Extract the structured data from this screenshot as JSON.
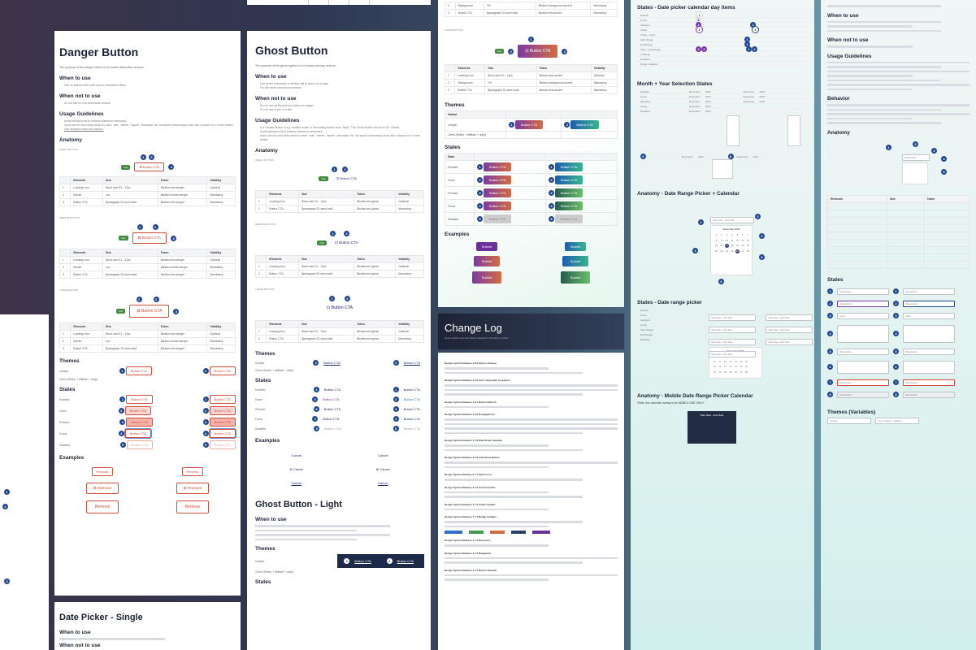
{
  "danger": {
    "title": "Danger Button",
    "intro": "The purpose of the danger button is to enable destructive actions.",
    "when_to_use": "When to use",
    "when_to_use_items": [
      "Use for actions that could have a destructive effect."
    ],
    "when_not": "When not to use",
    "when_not_items": [
      "Do not use for non-destructive actions"
    ],
    "usage": "Usage Guidelines",
    "usage_items": [
      "Avoid adding icons to buttons whenever necessary.",
      "Icons can be used when action is clear: 'add', 'delete', 'import', 'download' etc. but avoid unnecessary icons like a house on a 'home' button.",
      "Use sentence case with caution."
    ],
    "anatomy": "Anatomy",
    "small_label": "Small button",
    "medium_label": "Medium button",
    "large_label": "Large button",
    "cta": "Button CTA",
    "chip": "Chip",
    "table_headers": [
      "",
      "Elements",
      "Size",
      "Token",
      "Visibility"
    ],
    "table_rows": [
      [
        "1",
        "Leading Icon",
        "$icon.size.S1 - 12px",
        "$button.text.danger",
        "Optional"
      ],
      [
        "2",
        "Border",
        "1px",
        "$button.border.danger",
        "Mandatory"
      ],
      [
        "3",
        "Button CTA",
        "$paragraph.S1.semi-bold",
        "$button.text.danger",
        "Mandatory"
      ]
    ],
    "themes": "Themes",
    "theme_rows": [
      "Unstyle",
      "Client (Select + affiliate + unify)"
    ],
    "states": "States",
    "state_rows": [
      "Enabled",
      "Hover",
      "Pressed",
      "Focus",
      "Disabled"
    ],
    "examples": "Examples",
    "remove": "Remove"
  },
  "datepicker_single": {
    "title": "Date Picker - Single",
    "when_to_use": "When to use",
    "when_not": "When not to use"
  },
  "ghost": {
    "title": "Ghost Button",
    "intro": "The purpose of the ghost system is for tertiary primary actions.",
    "when_to_use": "When to use",
    "when_to_use_items": [
      "Use as the secondary or tertiary call to action on a page.",
      "For the fewer pronounced actions"
    ],
    "when_not": "When not to use",
    "when_not_items": [
      "Do not use as the primary button on a page.",
      "Do not use in lieu of a link"
    ],
    "usage": "Usage Guidelines",
    "usage_items": [
      "If a Primary Button is e.g. forward action, a Secondary Button is for 'Back'. The Ghost Button should be for 'Cancel'.",
      "Avoid adding icons to buttons whenever necessary.",
      "Icons can be used when action is clear: 'add', 'delete', 'import', 'download' etc. but avoid unnecessary icons like a house on a 'home' button."
    ],
    "anatomy": "Anatomy",
    "small_label": "Small button",
    "medium_label": "Medium button",
    "large_label": "Large button",
    "cta": "Button CTA",
    "chip": "Chip",
    "table_headers": [
      "",
      "Elements",
      "Size",
      "Token",
      "Visibility"
    ],
    "table_rows": [
      [
        "1",
        "Leading Icon",
        "$icon.size.S1 - 12px",
        "$button.text.ghost",
        "Optional"
      ],
      [
        "2",
        "Button CTA",
        "$paragraph.S1.semi-bold",
        "$button.text.ghost",
        "Mandatory"
      ]
    ],
    "themes": "Themes",
    "theme_rows": [
      "Unstyle",
      "Client (Select + affiliate + unify)"
    ],
    "states": "States",
    "state_rows": [
      "Enabled",
      "Hover",
      "Pressed",
      "Focus",
      "Disabled"
    ],
    "examples": "Examples",
    "cancel": "Cancel",
    "light_title": "Ghost Button - Light",
    "light_when_to_use": "When to use",
    "light_themes": "Themes",
    "light_states": "States"
  },
  "gradient": {
    "label": "Large button",
    "cta": "Button CTA",
    "chip": "Chip",
    "table_headers": [
      "",
      "Elements",
      "Size",
      "Token",
      "Visibility"
    ],
    "table_rows": [
      [
        "1",
        "Leading Icon",
        "$icon.size.S2 - 14px",
        "$button.text.accent",
        "Optional"
      ],
      [
        "2",
        "Background",
        "Fill",
        "$button.background.accent",
        "Mandatory"
      ],
      [
        "3",
        "Button CTA",
        "$paragraph.S1.semi-bold",
        "$button.text.accent",
        "Mandatory"
      ]
    ],
    "themes": "Themes",
    "theme_headers": [
      "Variant"
    ],
    "theme_rows": [
      "Unstyle",
      "Client (Select + affiliate + unify)"
    ],
    "states": "States",
    "state_header": "State",
    "state_rows": [
      "Enabled",
      "Hover",
      "Pressed",
      "Focus",
      "Disabled"
    ],
    "examples": "Examples",
    "submit": "Submit"
  },
  "changelog": {
    "title": "Change Log",
    "subtitle": "Here's what's new and what's changed in the library update",
    "entries": [
      "Design System Release 4.8.3 Option cleanup",
      "Design System Release 4.8.2 Icon component properties",
      "Design System Release 4.8.1 Button Refresh",
      "Design System Release 4.8.0 Propagate Fix",
      "Design System Release 4.7.9 Date Picker Updates",
      "Design System Release 4.7.8 Add Ghost Button",
      "Design System Release 4.7.7 Option List",
      "Design System Release 4.7.6 Form Input Fix",
      "Design System Release 4.7.5 Avatar Update",
      "Design System Release 4.7.4 Badge Updates",
      "Design System Release 4.7.3 New Icons",
      "Design System Release 4.7.2 Navigation",
      "Design System Release 4.7.1 Button Variants"
    ]
  },
  "datepicker": {
    "states_day": "States - Date picker calendar day items",
    "month_year": "Month + Year Selection States",
    "anatomy_range": "Anatomy - Date Range Picker + Calendar",
    "states_range": "States - Date range picker",
    "anatomy_mobile": "Anatomy - Mobile Date Range Picker Calendar",
    "mobile_note": "*Note: this calendar overlay is for MOBILE USE ONLY*",
    "day_rows": [
      "Default",
      "Hover",
      "Selected",
      "Today",
      "Today - Hover",
      "Start Range",
      "End Range",
      "Start + End Range",
      "In Range",
      "Disabled",
      "Range Disabled"
    ],
    "month_rows": [
      "Enabled",
      "Hover",
      "Selected",
      "Focus",
      "Disabled",
      "Month",
      "Year"
    ],
    "month": "December",
    "year": "2023",
    "calendar_month": "December 2023",
    "start_end": "Start Date - End Date",
    "label": "Label"
  },
  "formfield": {
    "when_to_use": "When to use",
    "when_not": "When not to use",
    "usage": "Usage Guidelines",
    "behavior": "Behavior",
    "anatomy": "Anatomy",
    "states": "States",
    "themes": "Themes (Variables)",
    "table_headers": [
      "Elements",
      "Size",
      "Token"
    ],
    "state_rows": [
      "Enabled",
      "Hover",
      "Focus",
      "Filled",
      "Error",
      "Disabled",
      "Read-only"
    ],
    "label": "Label",
    "placeholder": "Placeholder",
    "unstyle": "Unstyle",
    "client": "Client (Select + affiliate)"
  },
  "colors": {
    "navy": "#20478f",
    "danger": "#d34b3a",
    "grad_purple": "#7b3aa6",
    "grad_orange": "#d46b3f"
  }
}
